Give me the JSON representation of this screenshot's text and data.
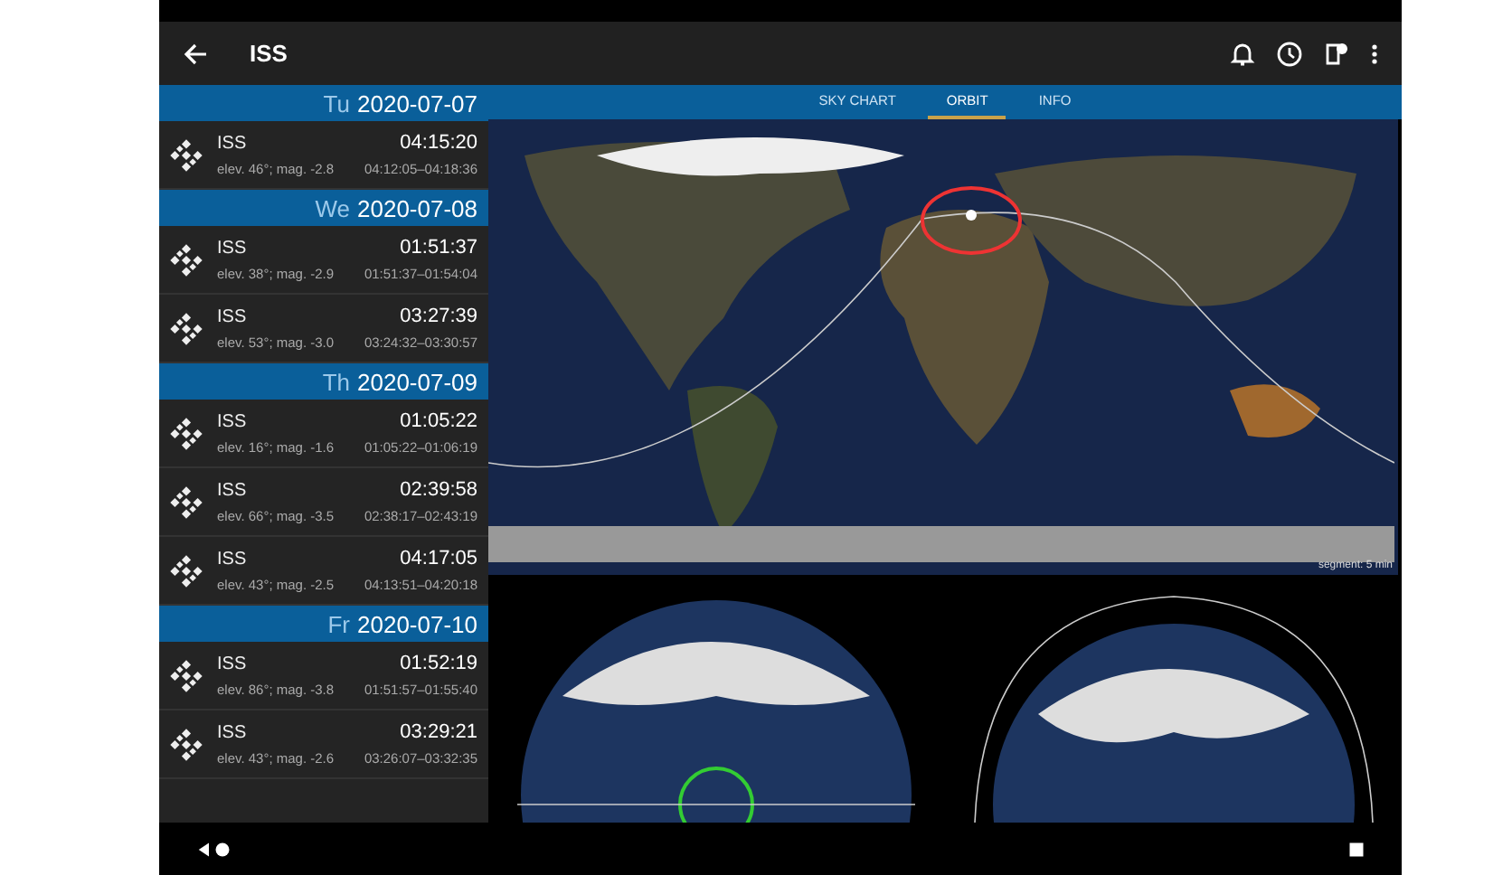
{
  "app_bar": {
    "title": "ISS"
  },
  "days": [
    {
      "weekday": "Tu",
      "date": "2020-07-07",
      "passes": [
        {
          "name": "ISS",
          "time": "04:15:20",
          "details": "elev. 46°; mag. -2.8",
          "window": "04:12:05–04:18:36"
        }
      ]
    },
    {
      "weekday": "We",
      "date": "2020-07-08",
      "passes": [
        {
          "name": "ISS",
          "time": "01:51:37",
          "details": "elev. 38°; mag. -2.9",
          "window": "01:51:37–01:54:04"
        },
        {
          "name": "ISS",
          "time": "03:27:39",
          "details": "elev. 53°; mag. -3.0",
          "window": "03:24:32–03:30:57"
        }
      ]
    },
    {
      "weekday": "Th",
      "date": "2020-07-09",
      "passes": [
        {
          "name": "ISS",
          "time": "01:05:22",
          "details": "elev. 16°; mag. -1.6",
          "window": "01:05:22–01:06:19"
        },
        {
          "name": "ISS",
          "time": "02:39:58",
          "details": "elev. 66°; mag. -3.5",
          "window": "02:38:17–02:43:19"
        },
        {
          "name": "ISS",
          "time": "04:17:05",
          "details": "elev. 43°; mag. -2.5",
          "window": "04:13:51–04:20:18"
        }
      ]
    },
    {
      "weekday": "Fr",
      "date": "2020-07-10",
      "passes": [
        {
          "name": "ISS",
          "time": "01:52:19",
          "details": "elev. 86°; mag. -3.8",
          "window": "01:51:57–01:55:40"
        },
        {
          "name": "ISS",
          "time": "03:29:21",
          "details": "elev. 43°; mag. -2.6",
          "window": "03:26:07–03:32:35"
        }
      ]
    }
  ],
  "tabs": [
    {
      "label": "SKY CHART",
      "selected": false
    },
    {
      "label": "ORBIT",
      "selected": true
    },
    {
      "label": "INFO",
      "selected": false
    }
  ],
  "map": {
    "caption": "segment: 5 min"
  }
}
